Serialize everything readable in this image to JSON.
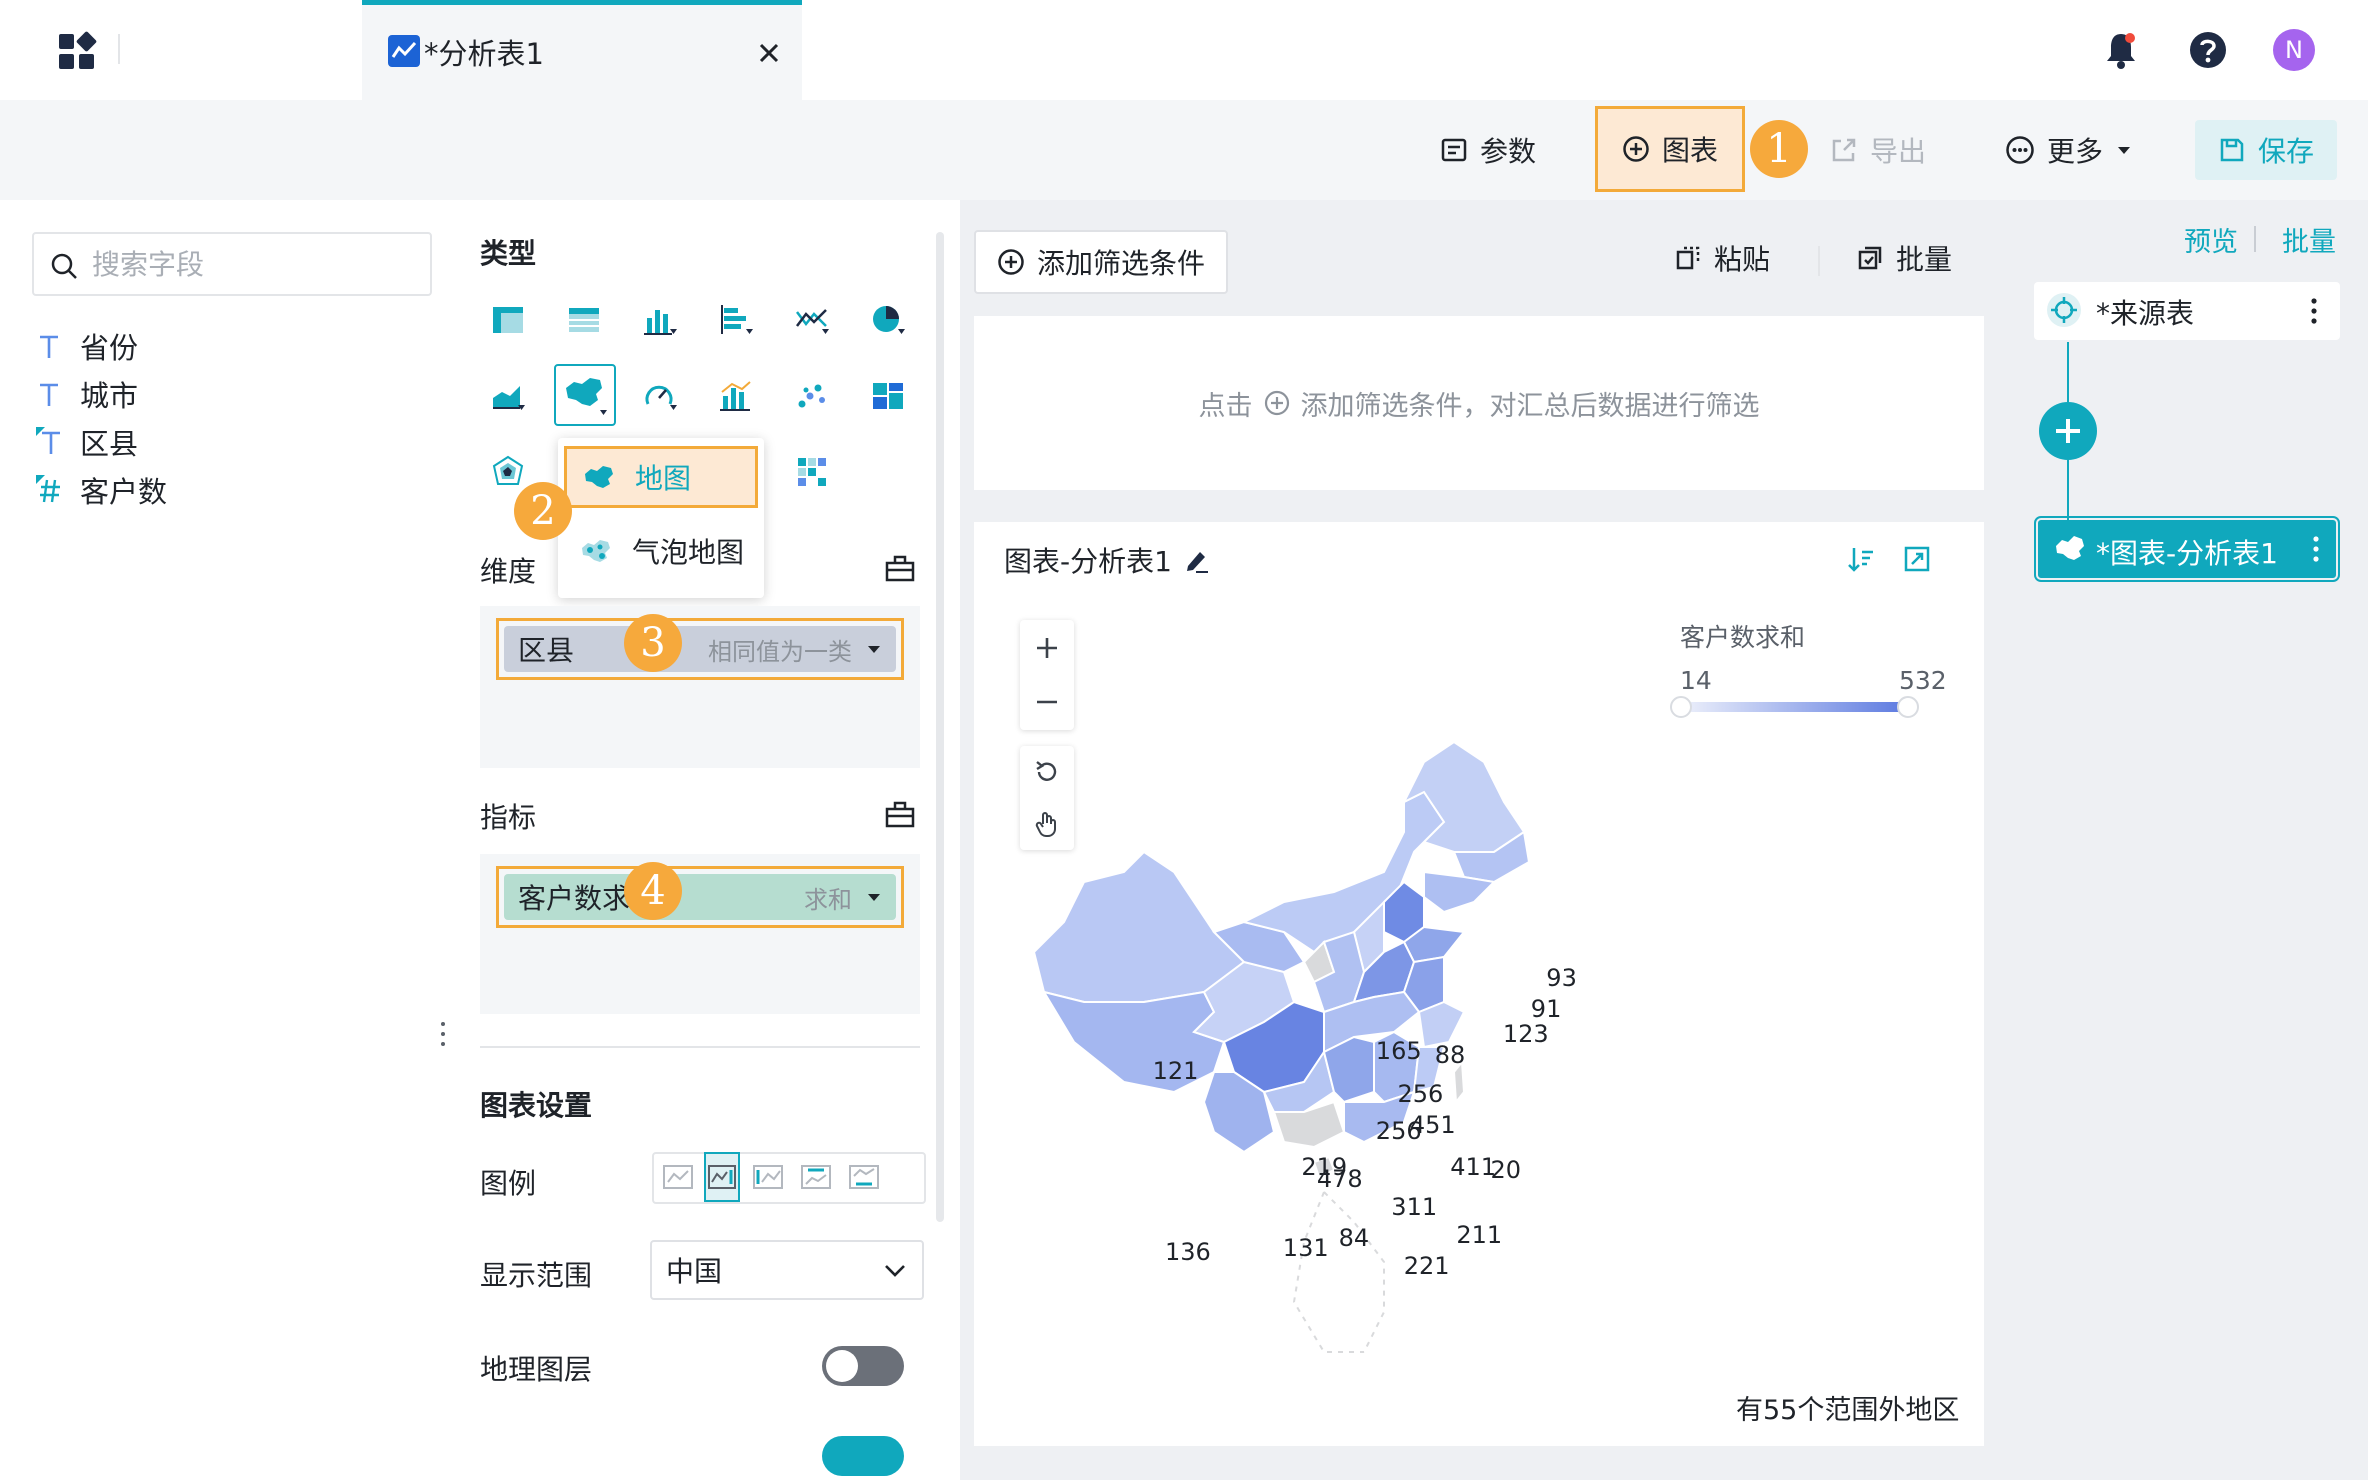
{
  "tab": {
    "label": "*分析表1",
    "close": "×"
  },
  "header": {
    "avatar_letter": "N"
  },
  "toolbar": {
    "params_label": "参数",
    "chart_label": "图表",
    "export_label": "导出",
    "more_label": "更多",
    "save_label": "保存"
  },
  "badges": [
    "1",
    "2",
    "3",
    "4"
  ],
  "fields": {
    "search_placeholder": "搜索字段",
    "items": [
      {
        "label": "省份",
        "type": "text"
      },
      {
        "label": "城市",
        "type": "text"
      },
      {
        "label": "区县",
        "type": "geo-text"
      },
      {
        "label": "客户数",
        "type": "geo-number"
      }
    ]
  },
  "config": {
    "type_title": "类型",
    "chart_type_popup": [
      "地图",
      "气泡地图"
    ],
    "dimension_label": "维度",
    "dimension_pill": {
      "name": "区县",
      "mode": "相同值为一类"
    },
    "metric_label": "指标",
    "metric_pill": {
      "name": "客户数求和",
      "mode": "求和"
    },
    "settings_title": "图表设置",
    "legend_label": "图例",
    "range_label": "显示范围",
    "range_value": "中国",
    "geo_layer_label": "地理图层"
  },
  "filter": {
    "add_label": "添加筛选条件",
    "paste_label": "粘贴",
    "batch_label": "批量",
    "empty_prefix": "点击",
    "empty_text": "添加筛选条件，对汇总后数据进行筛选"
  },
  "chart": {
    "title": "图表-分析表1",
    "legend_title": "客户数求和",
    "legend_min": "14",
    "legend_max": "532",
    "footer_note": "有55个范围外地区",
    "values": [
      "121",
      "136",
      "219",
      "256",
      "165",
      "88",
      "256",
      "451",
      "411",
      "20",
      "93",
      "91",
      "123",
      "478",
      "311",
      "84",
      "131",
      "211",
      "221"
    ],
    "colors": {
      "low": "#c6d2f6",
      "mid": "#9fb3ee",
      "high": "#6f8be4",
      "na": "#d9dadc"
    }
  },
  "flow": {
    "preview_label": "预览",
    "batch_label": "批量",
    "source_label": "*来源表",
    "chart_label": "*图表-分析表1"
  },
  "colors": {
    "accent": "#10a8bd",
    "highlight": "#f3aa39",
    "badge": "#f6a93c"
  }
}
